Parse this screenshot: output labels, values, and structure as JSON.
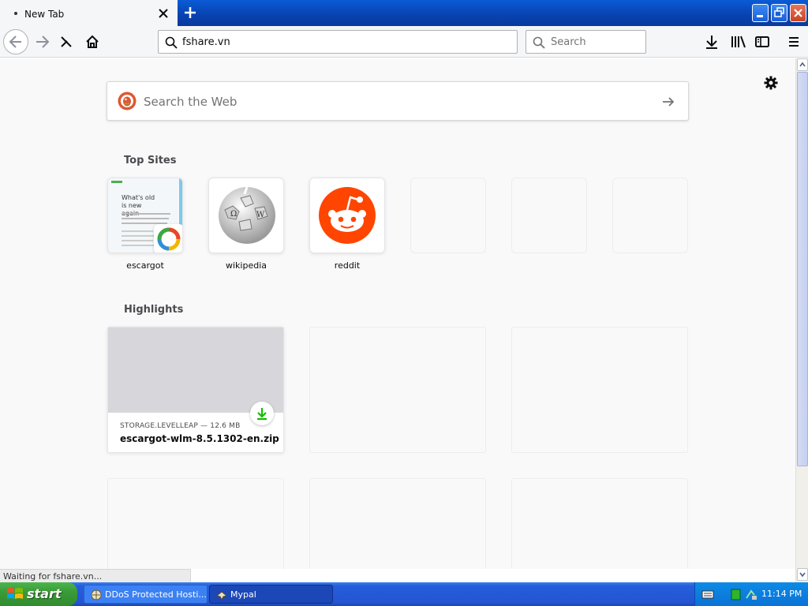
{
  "browser": {
    "tab": {
      "title": "New Tab"
    },
    "url": "fshare.vn",
    "search_placeholder": "Search"
  },
  "newtab": {
    "search_placeholder": "Search the Web",
    "top_sites_heading": "Top Sites",
    "top_sites": [
      {
        "label": "escargot",
        "thumb_heading": "What's old is new again"
      },
      {
        "label": "wikipedia"
      },
      {
        "label": "reddit"
      },
      {
        "label": ""
      },
      {
        "label": ""
      },
      {
        "label": ""
      }
    ],
    "highlights_heading": "Highlights",
    "highlights": [
      {
        "source": "STORAGE.LEVELLEAP — 12.6 MB",
        "title": "escargot-wlm-8.5.1302-en.zip"
      }
    ]
  },
  "status_text": "Waiting for fshare.vn...",
  "taskbar": {
    "start_label": "start",
    "tasks": [
      {
        "label": "DDoS Protected Hosti..."
      },
      {
        "label": "Mypal"
      }
    ],
    "clock": "11:14 PM"
  },
  "colors": {
    "reddit": "#ff4500",
    "download_green": "#12bc00",
    "taskbar_blue": "#245edb",
    "start_green": "#3a9b37"
  }
}
